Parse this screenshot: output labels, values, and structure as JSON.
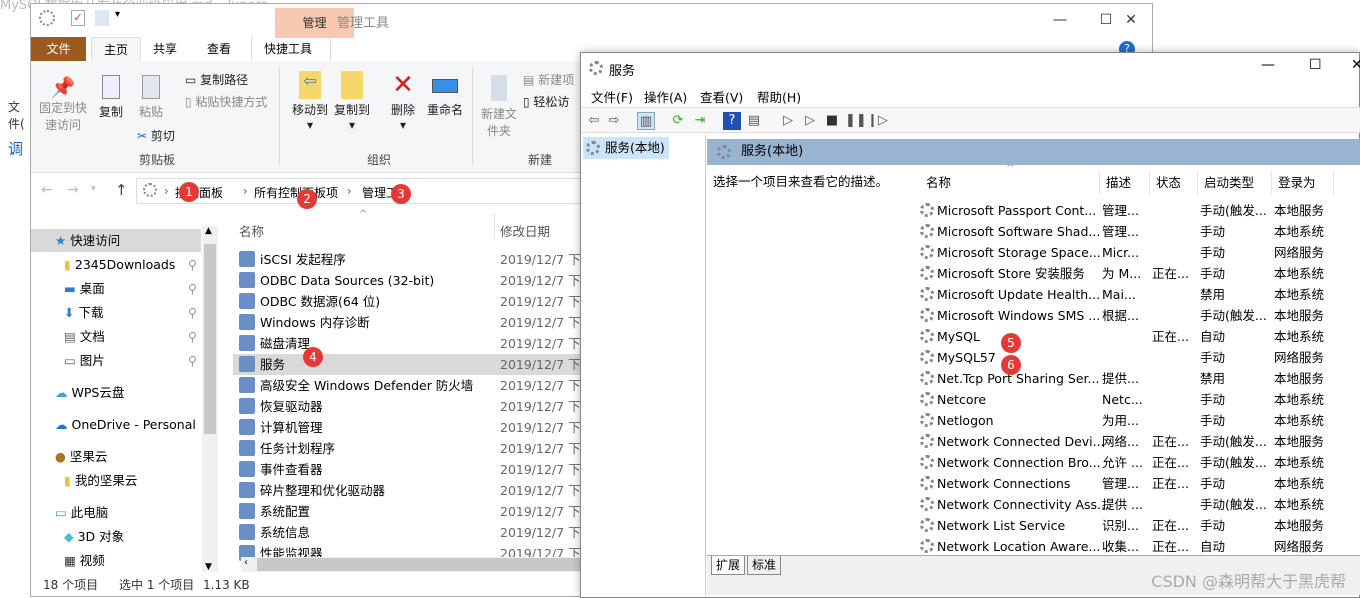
{
  "background_window": {
    "title": "MySQL数据库开发及企业级应用.md - Typora",
    "menu_file": "文件(",
    "side_text": "调"
  },
  "explorer": {
    "context_tab": "管理",
    "context_title": "管理工具",
    "tabs": [
      "文件",
      "主页",
      "共享",
      "查看",
      "快捷工具"
    ],
    "ribbon": {
      "pin": "固定到快速访问",
      "copy": "复制",
      "paste": "粘贴",
      "copy_path": "复制路径",
      "paste_shortcut": "粘贴快捷方式",
      "cut": "剪切",
      "group_clipboard": "剪贴板",
      "move_to": "移动到",
      "copy_to": "复制到",
      "delete": "删除",
      "rename": "重命名",
      "group_organize": "组织",
      "new_folder": "新建文件夹",
      "new_item": "新建项",
      "easy_access": "轻松访",
      "group_new": "新建"
    },
    "breadcrumb": [
      "控制面板",
      "所有控制面板项",
      "管理工具"
    ],
    "badges": [
      "1",
      "2",
      "3",
      "4"
    ],
    "nav": [
      {
        "label": "快速访问",
        "icon": "star-icon",
        "selected": true
      },
      {
        "label": "2345Downloads",
        "icon": "folder-icon",
        "pinned": true
      },
      {
        "label": "桌面",
        "icon": "desktop-icon",
        "pinned": true
      },
      {
        "label": "下载",
        "icon": "download-icon",
        "pinned": true
      },
      {
        "label": "文档",
        "icon": "document-icon",
        "pinned": true
      },
      {
        "label": "图片",
        "icon": "picture-icon",
        "pinned": true
      },
      {
        "label": "WPS云盘",
        "icon": "cloud-icon"
      },
      {
        "label": "OneDrive - Personal",
        "icon": "onedrive-icon"
      },
      {
        "label": "坚果云",
        "icon": "nut-icon"
      },
      {
        "label": "我的坚果云",
        "icon": "folder-icon"
      },
      {
        "label": "此电脑",
        "icon": "computer-icon"
      },
      {
        "label": "3D 对象",
        "icon": "cube-icon"
      },
      {
        "label": "视频",
        "icon": "video-icon"
      }
    ],
    "columns": {
      "name": "名称",
      "date": "修改日期"
    },
    "files": [
      {
        "name": "iSCSI 发起程序",
        "date": "2019/12/7 下午"
      },
      {
        "name": "ODBC Data Sources (32-bit)",
        "date": "2019/12/7 下午"
      },
      {
        "name": "ODBC 数据源(64 位)",
        "date": "2019/12/7 下午"
      },
      {
        "name": "Windows 内存诊断",
        "date": "2019/12/7 下午"
      },
      {
        "name": "磁盘清理",
        "date": "2019/12/7 下午"
      },
      {
        "name": "服务",
        "date": "2019/12/7 下午",
        "selected": true
      },
      {
        "name": "高级安全 Windows Defender 防火墙",
        "date": "2019/12/7 下午"
      },
      {
        "name": "恢复驱动器",
        "date": "2019/12/7 下午"
      },
      {
        "name": "计算机管理",
        "date": "2019/12/7 下午"
      },
      {
        "name": "任务计划程序",
        "date": "2019/12/7 下午"
      },
      {
        "name": "事件查看器",
        "date": "2019/12/7 下午"
      },
      {
        "name": "碎片整理和优化驱动器",
        "date": "2019/12/7 下午"
      },
      {
        "name": "系统配置",
        "date": "2019/12/7 下午"
      },
      {
        "name": "系统信息",
        "date": "2019/12/7 下午"
      },
      {
        "name": "性能监视器",
        "date": "2019/12/7 下午"
      }
    ],
    "status": {
      "count": "18 个项目",
      "selected": "选中 1 个项目",
      "size": "1.13 KB"
    }
  },
  "services": {
    "title": "服务",
    "menu": [
      "文件(F)",
      "操作(A)",
      "查看(V)",
      "帮助(H)"
    ],
    "tree_item": "服务(本地)",
    "panel_title": "服务(本地)",
    "description": "选择一个项目来查看它的描述。",
    "columns": [
      "名称",
      "描述",
      "状态",
      "启动类型",
      "登录为"
    ],
    "badges": [
      "5",
      "6"
    ],
    "rows": [
      [
        "Microsoft Passport Cont...",
        "管理...",
        "",
        "手动(触发...",
        "本地服务"
      ],
      [
        "Microsoft Software Shad...",
        "管理...",
        "",
        "手动",
        "本地系统"
      ],
      [
        "Microsoft Storage Space...",
        "Micr...",
        "",
        "手动",
        "网络服务"
      ],
      [
        "Microsoft Store 安装服务",
        "为 M...",
        "正在...",
        "手动",
        "本地系统"
      ],
      [
        "Microsoft Update Health...",
        "Mai...",
        "",
        "禁用",
        "本地系统"
      ],
      [
        "Microsoft Windows SMS ...",
        "根据...",
        "",
        "手动(触发...",
        "本地服务"
      ],
      [
        "MySQL",
        "",
        "正在...",
        "自动",
        "本地系统"
      ],
      [
        "MySQL57",
        "",
        "",
        "手动",
        "网络服务"
      ],
      [
        "Net.Tcp Port Sharing Ser...",
        "提供...",
        "",
        "禁用",
        "本地服务"
      ],
      [
        "Netcore",
        "Netc...",
        "",
        "手动",
        "本地系统"
      ],
      [
        "Netlogon",
        "为用...",
        "",
        "手动",
        "本地系统"
      ],
      [
        "Network Connected Devi...",
        "网络...",
        "正在...",
        "手动(触发...",
        "本地服务"
      ],
      [
        "Network Connection Bro...",
        "允许 ...",
        "正在...",
        "手动(触发...",
        "本地系统"
      ],
      [
        "Network Connections",
        "管理...",
        "正在...",
        "手动",
        "本地系统"
      ],
      [
        "Network Connectivity Ass...",
        "提供 ...",
        "",
        "手动(触发...",
        "本地系统"
      ],
      [
        "Network List Service",
        "识别...",
        "正在...",
        "手动",
        "本地服务"
      ],
      [
        "Network Location Aware...",
        "收集...",
        "正在...",
        "自动",
        "网络服务"
      ]
    ],
    "bottom_tabs": [
      "扩展",
      "标准"
    ]
  },
  "watermark": "CSDN @森明帮大于黑虎帮",
  "colors": {
    "badge": "#e53935",
    "file_tab": "#9b5a1e",
    "context_tab": "#f8c9b0",
    "panel_header": "#99b4d1",
    "selection": "#d9d9d9"
  }
}
